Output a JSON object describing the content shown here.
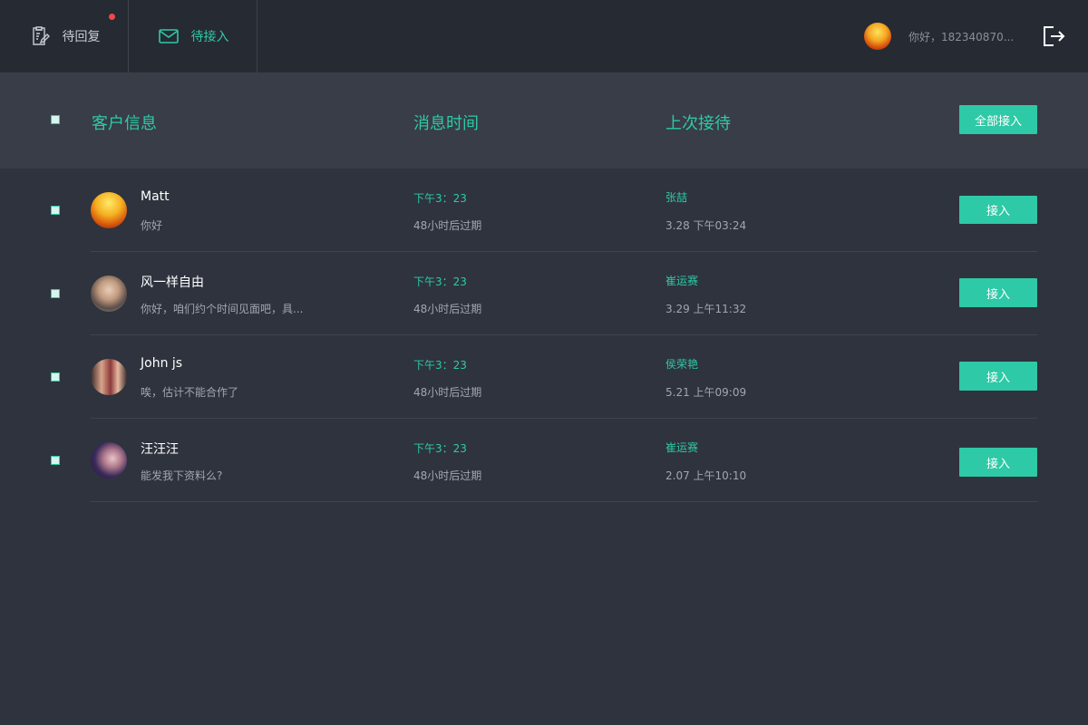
{
  "nav": {
    "tab_reply": "待回复",
    "tab_access": "待接入"
  },
  "user": {
    "greeting": "你好，182340870..."
  },
  "table": {
    "col_customer": "客户信息",
    "col_time": "消息时间",
    "col_last": "上次接待",
    "accept_all": "全部接入"
  },
  "rows": [
    {
      "name": "Matt",
      "message": "你好",
      "time": "下午3：23",
      "expire": "48小时后过期",
      "agent": "张喆",
      "last": "3.28  下午03:24",
      "button": "接入"
    },
    {
      "name": "风一样自由",
      "message": "你好，咱们约个时间见面吧，具...",
      "time": "下午3：23",
      "expire": "48小时后过期",
      "agent": "崔运赛",
      "last": "3.29  上午11:32",
      "button": "接入"
    },
    {
      "name": "John js",
      "message": "唉，估计不能合作了",
      "time": "下午3：23",
      "expire": "48小时后过期",
      "agent": "侯荣艳",
      "last": "5.21  上午09:09",
      "button": "接入"
    },
    {
      "name": "汪汪汪",
      "message": "能发我下资料么?",
      "time": "下午3：23",
      "expire": "48小时后过期",
      "agent": "崔运赛",
      "last": "2.07  上午10:10",
      "button": "接入"
    }
  ],
  "colors": {
    "accent": "#2ec9a6",
    "badge": "#f2474b",
    "background": "#2e333e",
    "topbar": "#262a33",
    "header": "#383d48"
  },
  "icons": {
    "reply_tab": "clipboard-edit-icon",
    "access_tab": "envelope-icon",
    "logout": "logout-icon"
  }
}
